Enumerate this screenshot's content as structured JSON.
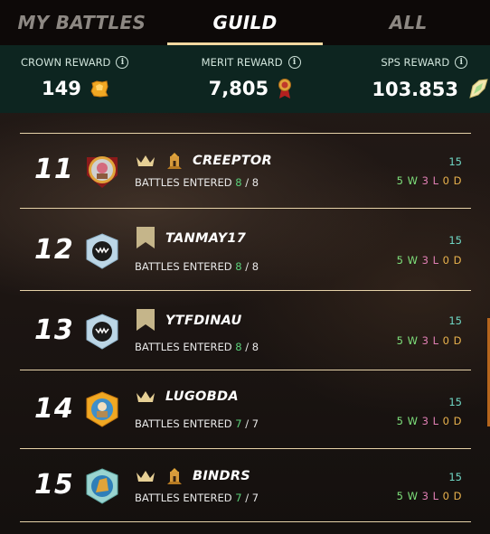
{
  "tabs": [
    {
      "label": "MY BATTLES",
      "active": false
    },
    {
      "label": "GUILD",
      "active": true
    },
    {
      "label": "ALL",
      "active": false
    }
  ],
  "rewards": {
    "crown": {
      "label": "CROWN REWARD",
      "value": "149",
      "icon": "crown-token-icon"
    },
    "merit": {
      "label": "MERIT REWARD",
      "value": "7,805",
      "icon": "merit-medal-icon"
    },
    "sps": {
      "label": "SPS REWARD",
      "value": "103.853",
      "icon": "sps-token-icon"
    }
  },
  "entries": [
    {
      "rank": "11",
      "name": "CREEPTOR",
      "entered_label": "BATTLES ENTERED",
      "entered": "8",
      "total": "8",
      "score": "15",
      "wins": "5 W",
      "losses": "3 L",
      "draws": "0 D",
      "badges": [
        "crown-icon",
        "guild-castle-icon"
      ]
    },
    {
      "rank": "12",
      "name": "TANMAY17",
      "entered_label": "BATTLES ENTERED",
      "entered": "8",
      "total": "8",
      "score": "15",
      "wins": "5 W",
      "losses": "3 L",
      "draws": "0 D",
      "badges": [
        "banner-icon"
      ]
    },
    {
      "rank": "13",
      "name": "YTFDINAU",
      "entered_label": "BATTLES ENTERED",
      "entered": "8",
      "total": "8",
      "score": "15",
      "wins": "5 W",
      "losses": "3 L",
      "draws": "0 D",
      "badges": [
        "banner-icon"
      ]
    },
    {
      "rank": "14",
      "name": "LUGOBDA",
      "entered_label": "BATTLES ENTERED",
      "entered": "7",
      "total": "7",
      "score": "15",
      "wins": "5 W",
      "losses": "3 L",
      "draws": "0 D",
      "badges": [
        "crown-icon"
      ]
    },
    {
      "rank": "15",
      "name": "BINDRS",
      "entered_label": "BATTLES ENTERED",
      "entered": "7",
      "total": "7",
      "score": "15",
      "wins": "5 W",
      "losses": "3 L",
      "draws": "0 D",
      "badges": [
        "crown-icon",
        "guild-castle-icon"
      ]
    }
  ],
  "colors": {
    "accent": "#f2d8a0",
    "reward_bar": "#0d2520",
    "win": "#7ee07b",
    "loss": "#e07fb4",
    "draw": "#e9b24d",
    "score": "#6fd6c4"
  }
}
